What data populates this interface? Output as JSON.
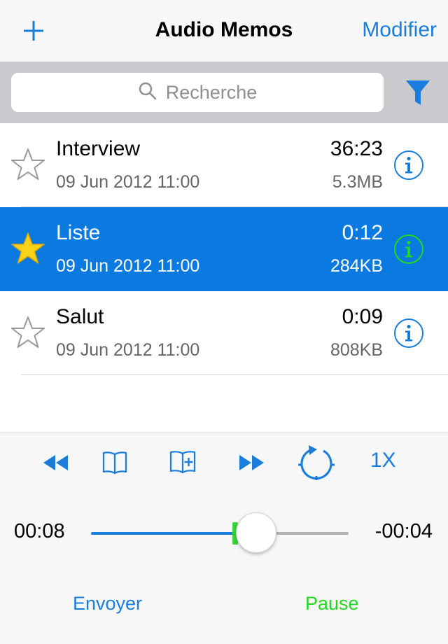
{
  "navbar": {
    "add_icon": "plus-icon",
    "title": "Audio Memos",
    "edit_label": "Modifier",
    "accent": "#1a7ddc"
  },
  "search": {
    "placeholder": "Recherche",
    "icon": "search-icon",
    "filter_icon": "filter-icon"
  },
  "memos": [
    {
      "title": "Interview",
      "date": "09 Jun 2012 11:00",
      "duration": "36:23",
      "size": "5.3MB",
      "starred": false,
      "selected": false
    },
    {
      "title": "Liste",
      "date": "09 Jun 2012 11:00",
      "duration": "0:12",
      "size": "284KB",
      "starred": true,
      "selected": true
    },
    {
      "title": "Salut",
      "date": "09 Jun 2012 11:00",
      "duration": "0:09",
      "size": "808KB",
      "starred": false,
      "selected": false
    }
  ],
  "player": {
    "controls": [
      "rewind-icon",
      "bookmark-icon",
      "add-bookmark-icon",
      "fast-forward-icon",
      "repeat-icon"
    ],
    "speed": "1X",
    "elapsed": "00:08",
    "remaining": "-00:04",
    "progress": 0.64,
    "send_label": "Envoyer",
    "pause_label": "Pause",
    "pause_color": "#22d822",
    "selected_row_color": "#0a7ae0"
  }
}
